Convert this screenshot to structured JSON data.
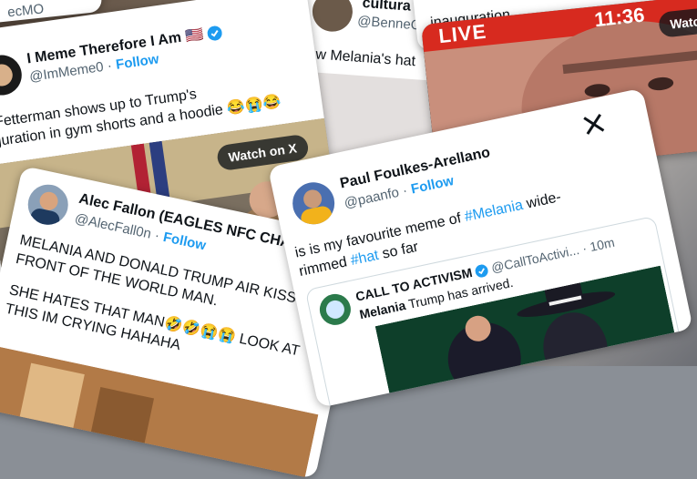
{
  "cards": {
    "top_left": {
      "handle_fragment": "ecMO"
    },
    "top_middle": {
      "handle": "@BenneCM",
      "name_fragment": "cultura",
      "text_fragment": "aw Melania's hat"
    },
    "top_right": {
      "text_fragment": "inauguration"
    },
    "live_card": {
      "live_label": "LIVE",
      "clock": "11:36",
      "watch_label": "Watc"
    },
    "meme": {
      "name": "I Meme Therefore I Am",
      "flag": "🇺🇸",
      "handle": "@ImMeme0",
      "follow": "Follow",
      "separator": "·",
      "text_line1": "n Fetterman shows up to Trump's",
      "text_line2": "uguration in gym shorts and a hoodie 😂😭😂",
      "watch_label": "Watch on X"
    },
    "alec": {
      "name": "Alec Fallon (EAGLES NFC CHAM...",
      "handle": "@AlecFall0n",
      "follow": "Follow",
      "separator": "·",
      "text_p1_line1": "MELANIA AND DONALD TRUMP AIR KISS IN",
      "text_p1_line2": "FRONT OF THE WORLD MAN.",
      "text_p2_line1": "SHE HATES THAT MAN🤣🤣😭😭 LOOK AT",
      "text_p2_line2": "THIS IM CRYING HAHAHA"
    },
    "paul": {
      "name": "Paul Foulkes-Arellano",
      "handle": "@paanfo",
      "follow": "Follow",
      "separator": "·",
      "text_a": "is is my favourite meme of ",
      "hashtag1": "#Melania",
      "text_b": " wide-",
      "text_c": "rimmed ",
      "hashtag2": "#hat",
      "text_d": " so far",
      "quote": {
        "name": "CALL TO ACTIVISM",
        "handle": "@CallToActivi...",
        "time": "· 10m",
        "text_bold": "Melania",
        "text_rest": " Trump has arrived."
      }
    }
  },
  "colors": {
    "link": "#1d9bf0",
    "verified": "#1d9bf0",
    "gold_verified": "#e2b719",
    "live_red": "#e0201b"
  },
  "icons": [
    "x-logo-icon",
    "verified-badge-icon",
    "play-icon"
  ]
}
